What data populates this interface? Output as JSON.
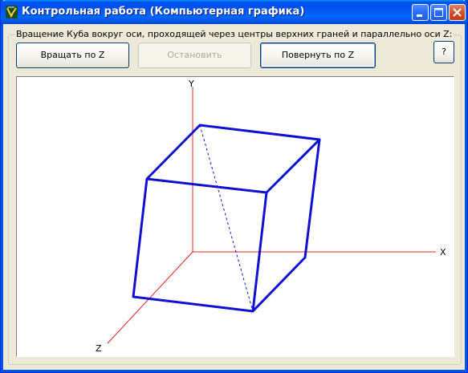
{
  "window": {
    "title": "Контрольная работа (Компьютерная графика)"
  },
  "group": {
    "caption": "Вращение Куба вокруг оси, проходящей через центры верхних граней и параллельно оси Z:"
  },
  "buttons": {
    "rotate": "Вращать по Z",
    "stop": "Остановить",
    "turn": "Повернуть по Z",
    "help": "?"
  },
  "axes": {
    "x": "X",
    "y": "Y",
    "z": "Z"
  },
  "colors": {
    "axis": "#e02020",
    "cube": "#1010d0",
    "title_bar": "#0055e5"
  },
  "icons": {
    "app": "delphi-app-icon",
    "minimize": "minimize-icon",
    "maximize": "maximize-icon",
    "close": "close-icon"
  }
}
